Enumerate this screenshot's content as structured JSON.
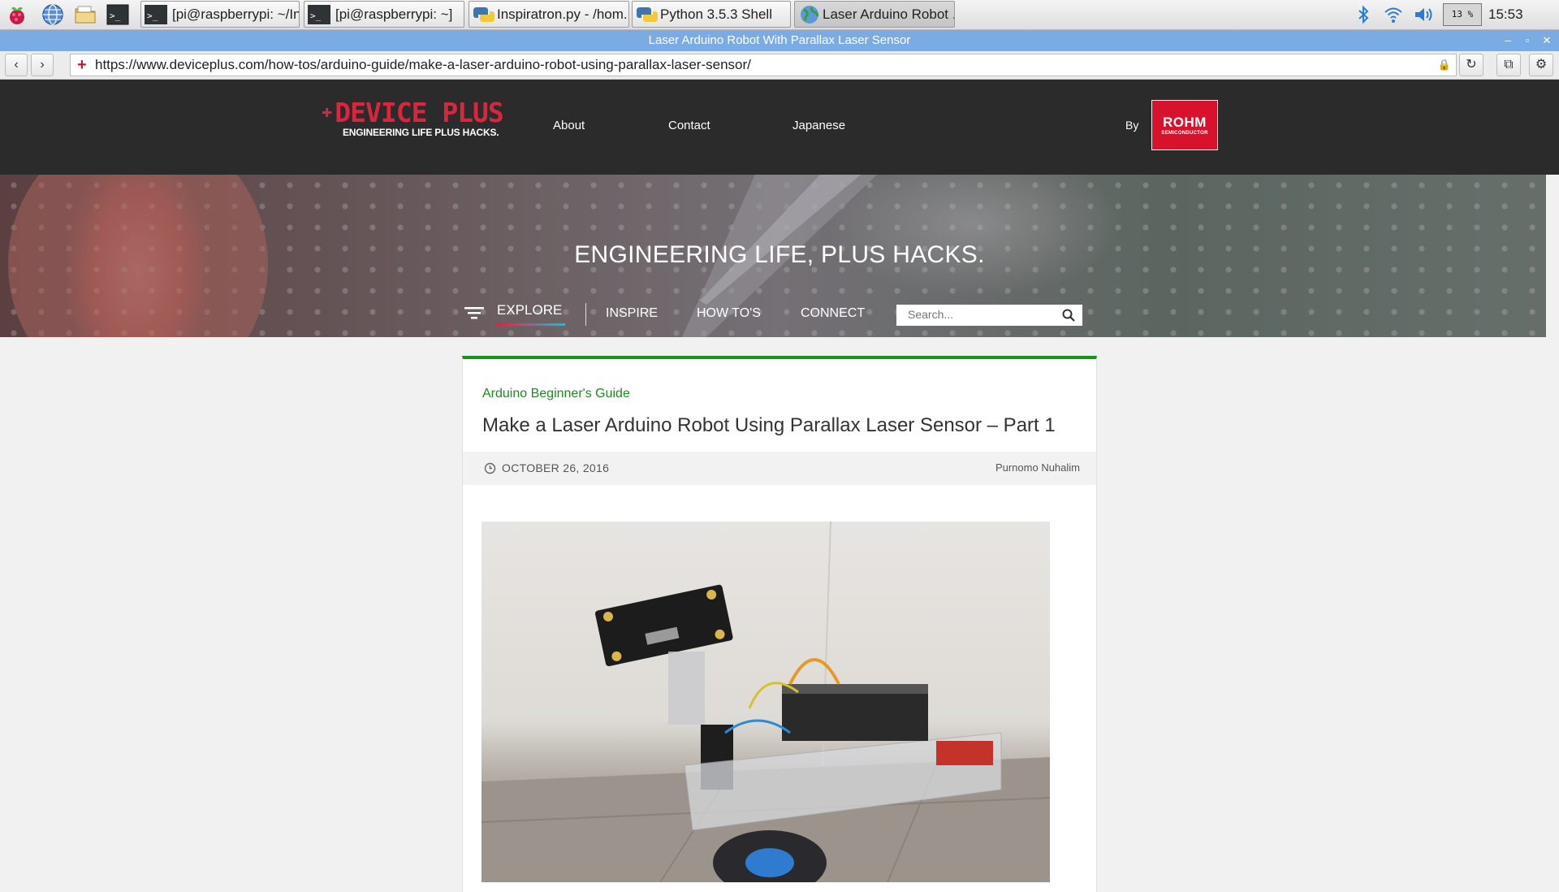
{
  "taskbar": {
    "tasks": [
      {
        "label": "[pi@raspberrypi: ~/In..."
      },
      {
        "label": "[pi@raspberrypi: ~]"
      },
      {
        "label": "Inspiratron.py - /hom..."
      },
      {
        "label": "Python 3.5.3 Shell"
      },
      {
        "label": "Laser Arduino Robot ..."
      }
    ],
    "cpu": "13 %",
    "clock": "15:53"
  },
  "window": {
    "title": "Laser Arduino Robot With Parallax Laser Sensor"
  },
  "browser": {
    "url": "https://www.deviceplus.com/how-tos/arduino-guide/make-a-laser-arduino-robot-using-parallax-laser-sensor/"
  },
  "site": {
    "logo_main": "DEVICE PLUS",
    "logo_tagline": "ENGINEERING LIFE PLUS HACKS.",
    "nav": [
      "About",
      "Contact",
      "Japanese"
    ],
    "by": "By",
    "rohm_name": "ROHM",
    "rohm_sub": "SEMICONDUCTOR"
  },
  "hero": {
    "title": "ENGINEERING LIFE, PLUS HACKS.",
    "nav": [
      "EXPLORE",
      "INSPIRE",
      "HOW TO'S",
      "CONNECT"
    ],
    "search_placeholder": "Search..."
  },
  "article": {
    "category": "Arduino Beginner's Guide",
    "title": "Make a Laser Arduino Robot Using Parallax Laser Sensor – Part 1",
    "date": "OCTOBER 26, 2016",
    "author": "Purnomo Nuhalim"
  },
  "colors": {
    "accent_green": "#1a9020",
    "brand_red": "#d8263e",
    "titlebar_blue": "#7aabe3"
  }
}
